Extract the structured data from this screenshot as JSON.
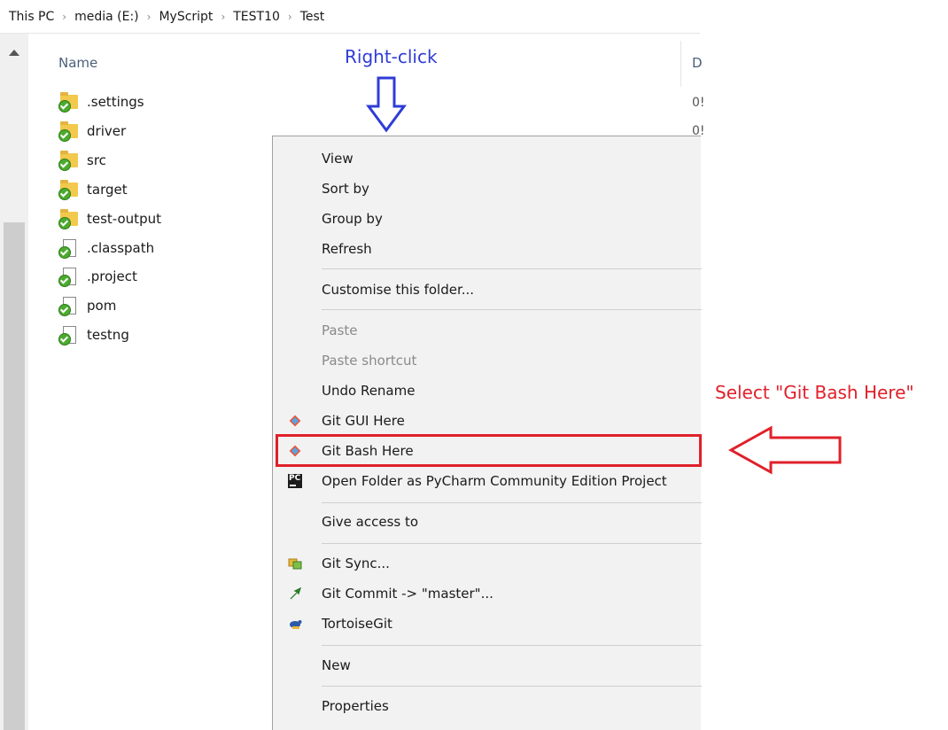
{
  "breadcrumb": [
    "This PC",
    "media (E:)",
    "MyScript",
    "TEST10",
    "Test"
  ],
  "breadcrumb_separator": "›",
  "columns": {
    "name": "Name",
    "date_partial": "D"
  },
  "files": [
    {
      "name": ".settings",
      "type": "folder"
    },
    {
      "name": "driver",
      "type": "folder"
    },
    {
      "name": "src",
      "type": "folder"
    },
    {
      "name": "target",
      "type": "folder"
    },
    {
      "name": "test-output",
      "type": "folder"
    },
    {
      "name": ".classpath",
      "type": "file"
    },
    {
      "name": ".project",
      "type": "file"
    },
    {
      "name": "pom",
      "type": "file"
    },
    {
      "name": "testng",
      "type": "file"
    }
  ],
  "date_peek": [
    "0!",
    "0!"
  ],
  "context_menu": {
    "items": [
      {
        "label": "View",
        "disabled": false
      },
      {
        "label": "Sort by",
        "disabled": false
      },
      {
        "label": "Group by",
        "disabled": false
      },
      {
        "label": "Refresh",
        "disabled": false
      },
      {
        "label": "Customise this folder...",
        "disabled": false
      },
      {
        "label": "Paste",
        "disabled": true
      },
      {
        "label": "Paste shortcut",
        "disabled": true
      },
      {
        "label": "Undo Rename",
        "disabled": false
      },
      {
        "label": "Git GUI Here",
        "disabled": false,
        "icon": "git-icon"
      },
      {
        "label": "Git Bash Here",
        "disabled": false,
        "icon": "git-icon"
      },
      {
        "label": "Open Folder as PyCharm Community Edition Project",
        "disabled": false,
        "icon": "pycharm-icon"
      },
      {
        "label": "Give access to",
        "disabled": false
      },
      {
        "label": "Git Sync...",
        "disabled": false,
        "icon": "git-sync-icon"
      },
      {
        "label": "Git Commit -> \"master\"...",
        "disabled": false,
        "icon": "git-commit-icon"
      },
      {
        "label": "TortoiseGit",
        "disabled": false,
        "icon": "tortoisegit-icon"
      },
      {
        "label": "New",
        "disabled": false
      },
      {
        "label": "Properties",
        "disabled": false
      }
    ],
    "pycharm_badge": "PC"
  },
  "annotations": {
    "right_click": "Right-click",
    "select": "Select \"Git Bash Here\""
  },
  "colors": {
    "annotation_blue": "#2f3cd6",
    "annotation_red": "#e0202a",
    "menu_background": "#f2f2f2",
    "git_orange": "#f05133"
  }
}
